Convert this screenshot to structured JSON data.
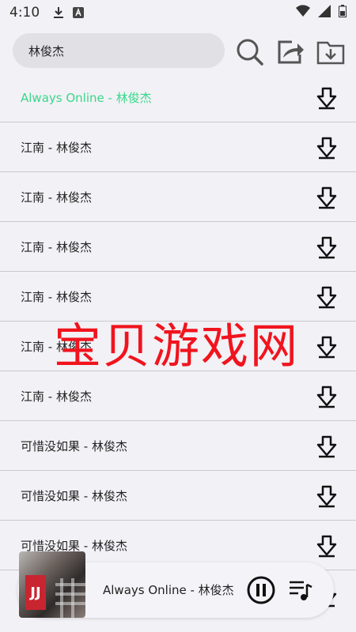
{
  "status_bar": {
    "time": "4:10",
    "icons": [
      "download-icon",
      "a-icon",
      "wifi-icon",
      "signal-icon",
      "battery-icon"
    ]
  },
  "search": {
    "value": "林俊杰"
  },
  "toolbar": {
    "icons": [
      "search-icon",
      "share-icon",
      "download-folder-icon"
    ]
  },
  "songs": [
    {
      "title": "Always Online - 林俊杰",
      "active": true
    },
    {
      "title": "江南 - 林俊杰"
    },
    {
      "title": "江南 - 林俊杰"
    },
    {
      "title": "江南 - 林俊杰"
    },
    {
      "title": "江南 - 林俊杰"
    },
    {
      "title": "江南 - 林俊杰"
    },
    {
      "title": "江南 - 林俊杰"
    },
    {
      "title": "可惜没如果 - 林俊杰"
    },
    {
      "title": "可惜没如果 - 林俊杰"
    },
    {
      "title": "可惜没如果 - 林俊杰"
    }
  ],
  "watermark": "宝贝游戏网",
  "player": {
    "now_playing": "Always Online - 林俊杰",
    "cover_text": "JJ"
  },
  "colors": {
    "active": "#3ad78c",
    "watermark": "#f0141e",
    "background": "#f2f1f5"
  }
}
